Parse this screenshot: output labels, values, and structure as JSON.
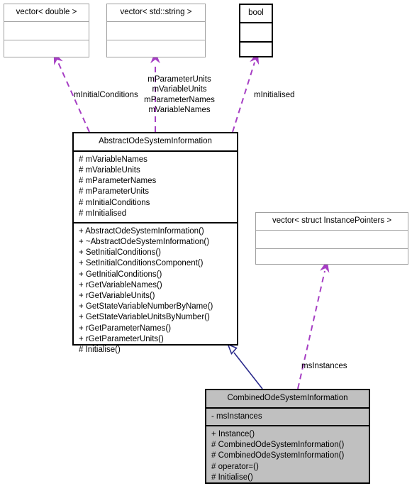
{
  "diagram": {
    "type": "uml-class-diagram",
    "accent_usage_color": "#a63ec4",
    "accent_inheritance_color": "#2a2a8c",
    "node_fill_highlight": "#c0c0c0",
    "node_fill_default": "#ffffff"
  },
  "nodes": {
    "vector_double": {
      "title": "vector< double >",
      "attributes": [],
      "operations": [],
      "style": "thin"
    },
    "vector_string": {
      "title": "vector< std::string >",
      "attributes": [],
      "operations": [],
      "style": "thin"
    },
    "bool": {
      "title": "bool",
      "attributes": [],
      "operations": [],
      "style": "thick"
    },
    "vector_instance_pointers": {
      "title": "vector< struct InstancePointers >",
      "attributes": [],
      "operations": [],
      "style": "thin"
    },
    "abstract_ode_system_information": {
      "title": "AbstractOdeSystemInformation",
      "attributes": [
        "# mVariableNames",
        "# mVariableUnits",
        "# mParameterNames",
        "# mParameterUnits",
        "# mInitialConditions",
        "# mInitialised"
      ],
      "operations": [
        "+ AbstractOdeSystemInformation()",
        "+ ~AbstractOdeSystemInformation()",
        "+ SetInitialConditions()",
        "+ SetInitialConditionsComponent()",
        "+ GetInitialConditions()",
        "+ rGetVariableNames()",
        "+ rGetVariableUnits()",
        "+ GetStateVariableNumberByName()",
        "+ GetStateVariableUnitsByNumber()",
        "+ rGetParameterNames()",
        "+ rGetParameterUnits()",
        "# Initialise()"
      ],
      "style": "thick"
    },
    "combined_ode_system_information": {
      "title": "CombinedOdeSystemInformation",
      "attributes": [
        "- msInstances"
      ],
      "operations": [
        "+ Instance()",
        "# CombinedOdeSystemInformation()",
        "# CombinedOdeSystemInformation()",
        "# operator=()",
        "# Initialise()"
      ],
      "style": "thick filled"
    }
  },
  "edges": {
    "initial_conditions": {
      "label": "mInitialConditions",
      "kind": "usage"
    },
    "parameter_and_variable": {
      "label_lines": [
        "mParameterUnits",
        "mVariableUnits",
        "mParameterNames",
        "mVariableNames"
      ],
      "kind": "usage"
    },
    "initialised": {
      "label": "mInitialised",
      "kind": "usage"
    },
    "ms_instances": {
      "label": "msInstances",
      "kind": "usage"
    },
    "inheritance": {
      "label": "",
      "kind": "generalization"
    }
  }
}
